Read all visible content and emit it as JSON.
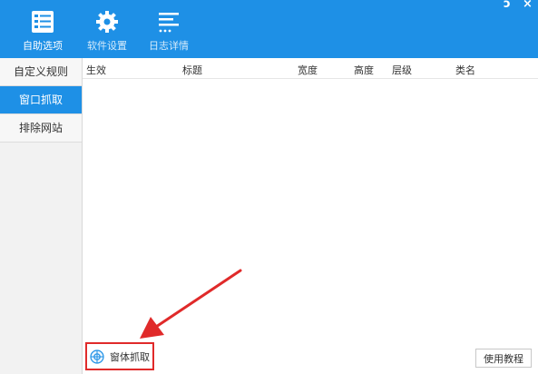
{
  "toolbar": {
    "items": [
      {
        "label": "自助选项",
        "icon": "checklist-icon"
      },
      {
        "label": "软件设置",
        "icon": "gear-icon"
      },
      {
        "label": "日志详情",
        "icon": "list-icon"
      }
    ]
  },
  "window_controls": {
    "restore": "ɔ",
    "close": "×"
  },
  "sidebar": {
    "items": [
      {
        "label": "自定义规则"
      },
      {
        "label": "窗口抓取"
      },
      {
        "label": "排除网站"
      }
    ]
  },
  "table": {
    "columns": [
      "生效",
      "标题",
      "宽度",
      "高度",
      "层级",
      "类名"
    ],
    "rows": []
  },
  "actions": {
    "grab_window": "窗体抓取",
    "tutorial": "使用教程"
  },
  "colors": {
    "accent": "#1e90e6",
    "highlight": "#e02a2a"
  }
}
